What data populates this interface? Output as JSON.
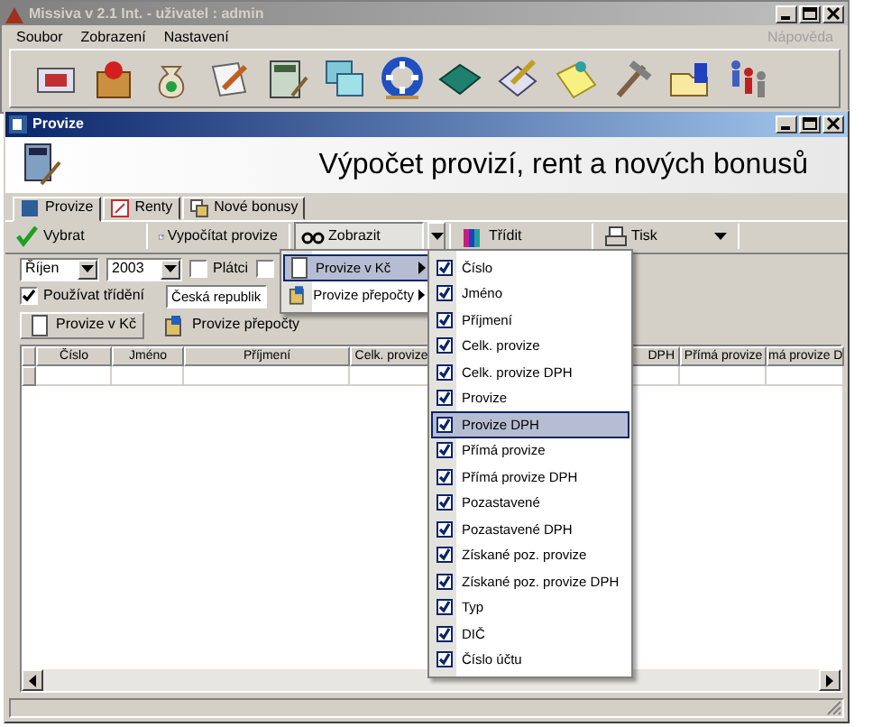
{
  "app": {
    "title": "Missiva v 2.1 Int. - uživatel : admin",
    "menu": [
      {
        "label": "Soubor"
      },
      {
        "label": "Zobrazení"
      },
      {
        "label": "Nastavení"
      }
    ],
    "help": {
      "label": "Nápověda",
      "disabled": true
    }
  },
  "window": {
    "title": "Provize",
    "heading": "Výpočet provizí, rent a nových bonusů"
  },
  "tabs": [
    {
      "label": "Provize",
      "selected": true
    },
    {
      "label": "Renty",
      "selected": false
    },
    {
      "label": "Nové bonusy",
      "selected": false
    }
  ],
  "toolbar": [
    {
      "label": "Vybrat",
      "kind": "button",
      "pressed": false
    },
    {
      "label": "Vypočítat provize",
      "kind": "button",
      "pressed": false
    },
    {
      "label": "Zobrazit",
      "kind": "split",
      "pressed": true
    },
    {
      "label": "Třídit",
      "kind": "button",
      "pressed": false
    },
    {
      "label": "Tisk",
      "kind": "dropdown",
      "pressed": false
    }
  ],
  "filters": {
    "month": "Říjen",
    "year": "2003",
    "checks": [
      {
        "label": "Plátci",
        "checked": false
      },
      {
        "checked": false
      }
    ],
    "sort": {
      "label": "Používat třídění",
      "checked": true
    },
    "country": "Česká republik"
  },
  "subtabs": [
    {
      "label": "Provize v Kč",
      "selected": true
    },
    {
      "label": "Provize přepočty",
      "selected": false
    }
  ],
  "table": {
    "columns": [
      "Číslo",
      "Jméno",
      "Příjmení",
      "Celk. provize",
      "DPH",
      "Přímá provize",
      "má provize D"
    ]
  },
  "submenu": [
    {
      "label": "Provize v Kč",
      "selected": true
    },
    {
      "label": "Provize přepočty",
      "selected": false
    }
  ],
  "column_menu": [
    {
      "label": "Číslo",
      "checked": true,
      "selected": false
    },
    {
      "label": "Jméno",
      "checked": true,
      "selected": false
    },
    {
      "label": "Příjmení",
      "checked": true,
      "selected": false
    },
    {
      "label": "Celk. provize",
      "checked": true,
      "selected": false
    },
    {
      "label": "Celk. provize DPH",
      "checked": true,
      "selected": false
    },
    {
      "label": "Provize",
      "checked": true,
      "selected": false
    },
    {
      "label": "Provize DPH",
      "checked": true,
      "selected": true
    },
    {
      "label": "Přímá provize",
      "checked": true,
      "selected": false
    },
    {
      "label": "Přímá provize DPH",
      "checked": true,
      "selected": false
    },
    {
      "label": "Pozastavené",
      "checked": true,
      "selected": false
    },
    {
      "label": "Pozastavené DPH",
      "checked": true,
      "selected": false
    },
    {
      "label": "Získané poz. provize",
      "checked": true,
      "selected": false
    },
    {
      "label": "Získané poz. provize DPH",
      "checked": true,
      "selected": false
    },
    {
      "label": "Typ",
      "checked": true,
      "selected": false
    },
    {
      "label": "DIČ",
      "checked": true,
      "selected": false
    },
    {
      "label": "Číslo účtu",
      "checked": true,
      "selected": false
    }
  ]
}
